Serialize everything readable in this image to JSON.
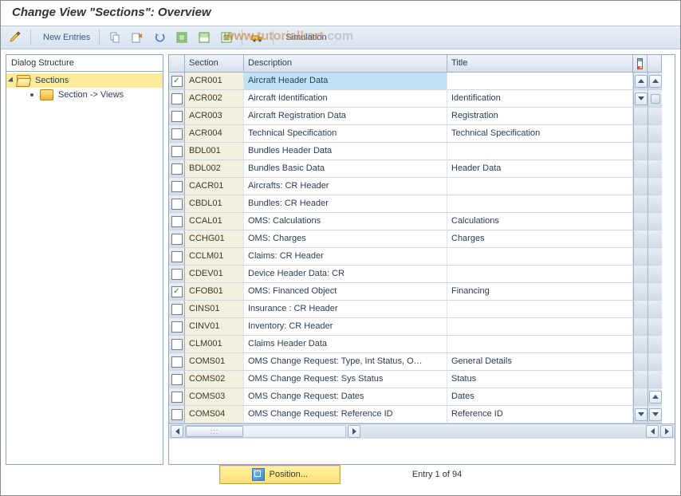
{
  "title": "Change View \"Sections\": Overview",
  "toolbar": {
    "new_entries": "New Entries",
    "simulation": "Simulation"
  },
  "watermark": {
    "p1": "www.",
    "p2": "tutorialkart",
    "p3": ".com"
  },
  "tree": {
    "header": "Dialog Structure",
    "root": "Sections",
    "child": "Section -> Views"
  },
  "grid": {
    "headers": {
      "section": "Section",
      "description": "Description",
      "title": "Title"
    },
    "rows": [
      {
        "section": "ACR001",
        "description": "Aircraft Header Data",
        "title": ""
      },
      {
        "section": "ACR002",
        "description": "Aircraft Identification",
        "title": "Identification"
      },
      {
        "section": "ACR003",
        "description": "Aircraft Registration Data",
        "title": "Registration"
      },
      {
        "section": "ACR004",
        "description": "Technical Specification",
        "title": "Technical Specification"
      },
      {
        "section": "BDL001",
        "description": "Bundles Header Data",
        "title": ""
      },
      {
        "section": "BDL002",
        "description": "Bundles Basic Data",
        "title": "Header Data"
      },
      {
        "section": "CACR01",
        "description": "Aircrafts: CR Header",
        "title": ""
      },
      {
        "section": "CBDL01",
        "description": "Bundles: CR Header",
        "title": ""
      },
      {
        "section": "CCAL01",
        "description": "OMS: Calculations",
        "title": "Calculations"
      },
      {
        "section": "CCHG01",
        "description": "OMS: Charges",
        "title": "Charges"
      },
      {
        "section": "CCLM01",
        "description": "Claims: CR Header",
        "title": ""
      },
      {
        "section": "CDEV01",
        "description": "Device Header Data: CR",
        "title": ""
      },
      {
        "section": "CFOB01",
        "description": "OMS: Financed Object",
        "title": "Financing"
      },
      {
        "section": "CINS01",
        "description": "Insurance : CR Header",
        "title": ""
      },
      {
        "section": "CINV01",
        "description": "Inventory: CR Header",
        "title": ""
      },
      {
        "section": "CLM001",
        "description": "Claims Header Data",
        "title": ""
      },
      {
        "section": "COMS01",
        "description": "OMS Change Request: Type, Int Status, O…",
        "title": "General Details"
      },
      {
        "section": "COMS02",
        "description": "OMS Change Request: Sys Status",
        "title": "Status"
      },
      {
        "section": "COMS03",
        "description": "OMS Change Request: Dates",
        "title": "Dates"
      },
      {
        "section": "COMS04",
        "description": "OMS Change Request: Reference ID",
        "title": "Reference ID"
      }
    ],
    "checked_rows": [
      0,
      12
    ]
  },
  "footer": {
    "position_button": "Position...",
    "entry_text": "Entry 1 of 94"
  }
}
